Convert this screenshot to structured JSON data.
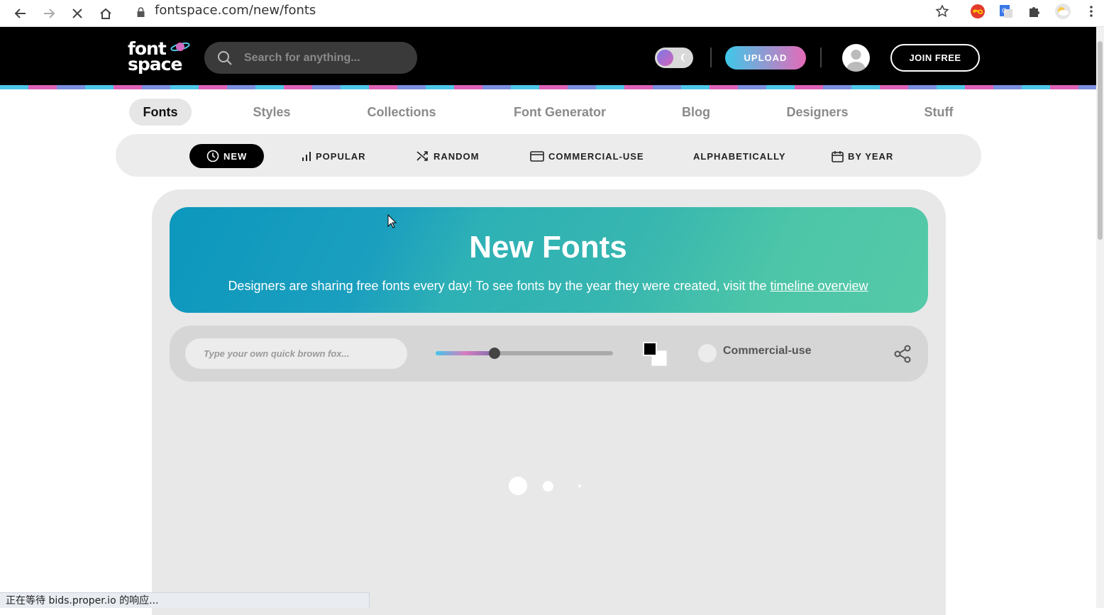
{
  "browser": {
    "url": "fontspace.com/new/fonts",
    "status_text": "正在等待 bids.proper.io 的响应..."
  },
  "header": {
    "logo_text_line1": "font",
    "logo_text_line2": "space",
    "search_placeholder": "Search for anything...",
    "upload_label": "UPLOAD",
    "join_label": "JOIN FREE"
  },
  "main_nav": [
    {
      "label": "Fonts",
      "active": true
    },
    {
      "label": "Styles"
    },
    {
      "label": "Collections"
    },
    {
      "label": "Font Generator"
    },
    {
      "label": "Blog"
    },
    {
      "label": "Designers"
    },
    {
      "label": "Stuff"
    }
  ],
  "sub_nav": [
    {
      "label": "NEW",
      "icon": "clock-icon",
      "active": true
    },
    {
      "label": "POPULAR",
      "icon": "bar-chart-icon"
    },
    {
      "label": "RANDOM",
      "icon": "shuffle-icon"
    },
    {
      "label": "COMMERCIAL-USE",
      "icon": "credit-card-icon"
    },
    {
      "label": "ALPHABETICALLY"
    },
    {
      "label": "BY YEAR",
      "icon": "calendar-icon"
    }
  ],
  "hero": {
    "title": "New Fonts",
    "subtitle": "Designers are sharing free fonts every day! To see fonts by the year they were created, visit the ",
    "link_text": "timeline overview"
  },
  "toolbar": {
    "preview_placeholder": "Type your own quick brown fox...",
    "size_level": 0.33,
    "commercial_label": "Commercial-use"
  },
  "colors": {
    "header_bg": "#000000",
    "accent_cyan": "#3ec8ea",
    "accent_pink": "#e56ab8"
  }
}
